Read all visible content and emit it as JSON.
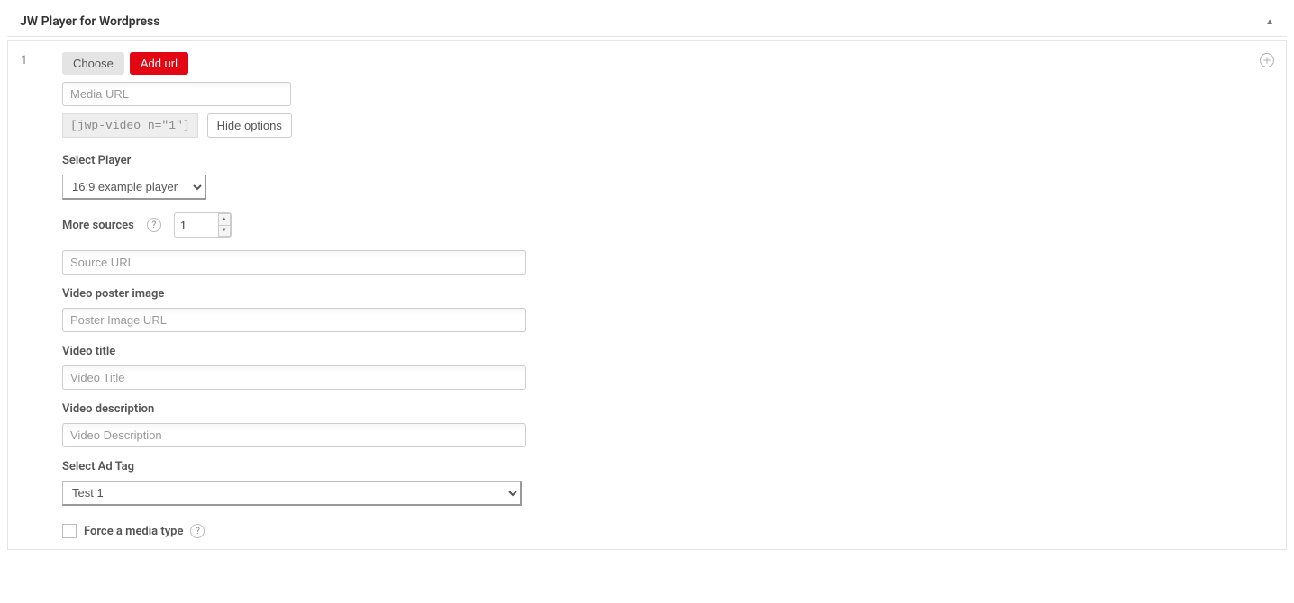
{
  "panel": {
    "title": "JW Player for Wordpress",
    "item_number": "1"
  },
  "buttons": {
    "choose": "Choose",
    "add_url": "Add url",
    "hide_options": "Hide options"
  },
  "shortcode": "[jwp-video n=\"1\"]",
  "inputs": {
    "media_url_placeholder": "Media URL",
    "source_url_placeholder": "Source URL",
    "poster_url_placeholder": "Poster Image URL",
    "video_title_placeholder": "Video Title",
    "video_desc_placeholder": "Video Description"
  },
  "labels": {
    "select_player": "Select Player",
    "more_sources": "More sources",
    "poster_image": "Video poster image",
    "video_title": "Video title",
    "video_desc": "Video description",
    "select_ad_tag": "Select Ad Tag",
    "force_media_type": "Force a media type"
  },
  "selects": {
    "player_value": "16:9 example player",
    "ad_tag_value": "Test 1"
  },
  "more_sources_value": "1"
}
